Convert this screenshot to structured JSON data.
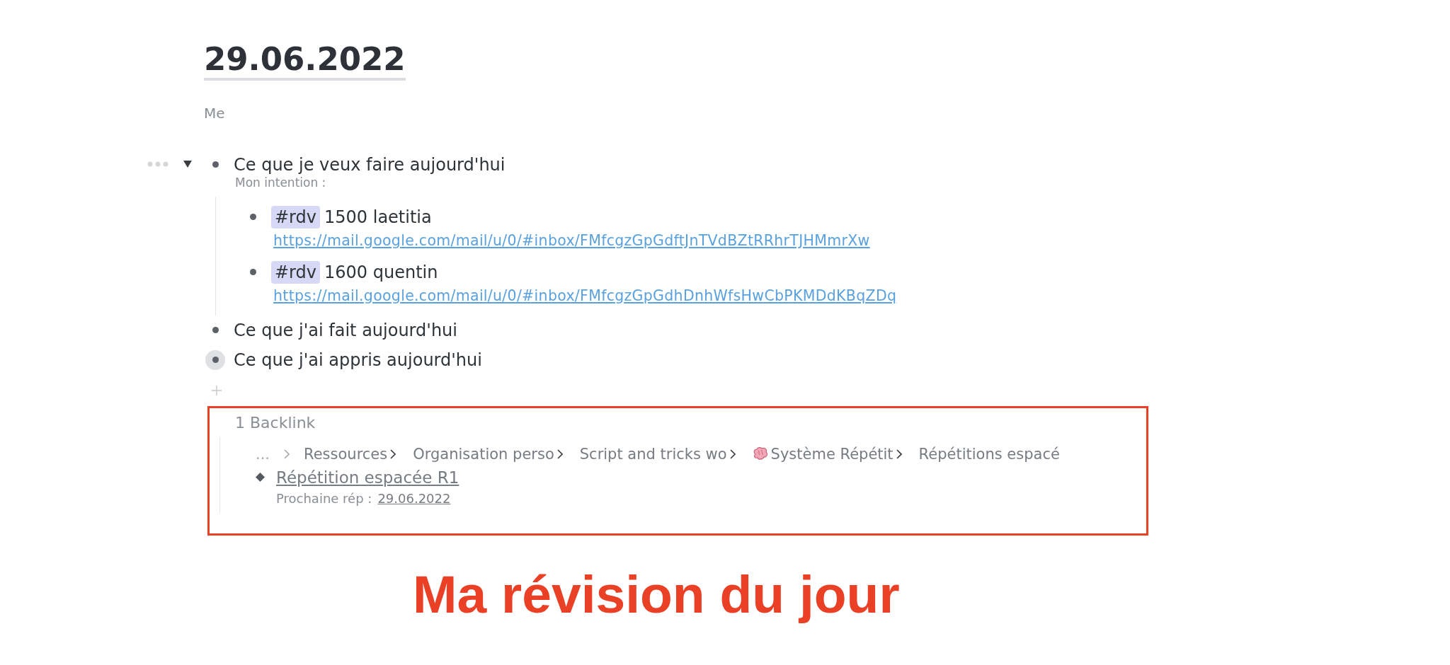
{
  "page": {
    "title": "29.06.2022",
    "subtitle": "Me"
  },
  "blocks": [
    {
      "text": "Ce que je veux faire aujourd'hui",
      "note": "Mon intention :",
      "expanded": true,
      "focused": false,
      "children": [
        {
          "tag": "#rdv",
          "text": "1500 laetitia",
          "link": "https://mail.google.com/mail/u/0/#inbox/FMfcgzGpGdftJnTVdBZtRRhrTJHMmrXw"
        },
        {
          "tag": "#rdv",
          "text": "1600 quentin",
          "link": "https://mail.google.com/mail/u/0/#inbox/FMfcgzGpGdhDnhWfsHwCbPKMDdKBqZDq"
        }
      ]
    },
    {
      "text": "Ce que j'ai fait aujourd'hui",
      "focused": false
    },
    {
      "text": "Ce que j'ai appris aujourd'hui",
      "focused": true
    }
  ],
  "backlinks": {
    "count_label": "1 Backlink",
    "breadcrumb": [
      {
        "label": "..."
      },
      {
        "label": "Ressources"
      },
      {
        "label": "Organisation perso"
      },
      {
        "label": "Script and tricks wo"
      },
      {
        "label": "Système Répétit",
        "has_icon": true
      },
      {
        "label": "Répétitions espacé"
      }
    ],
    "items": [
      {
        "title": "Répétition espacée R1",
        "property": "Prochaine rép :",
        "value": "29.06.2022"
      }
    ]
  },
  "annotation": "Ma révision du jour"
}
